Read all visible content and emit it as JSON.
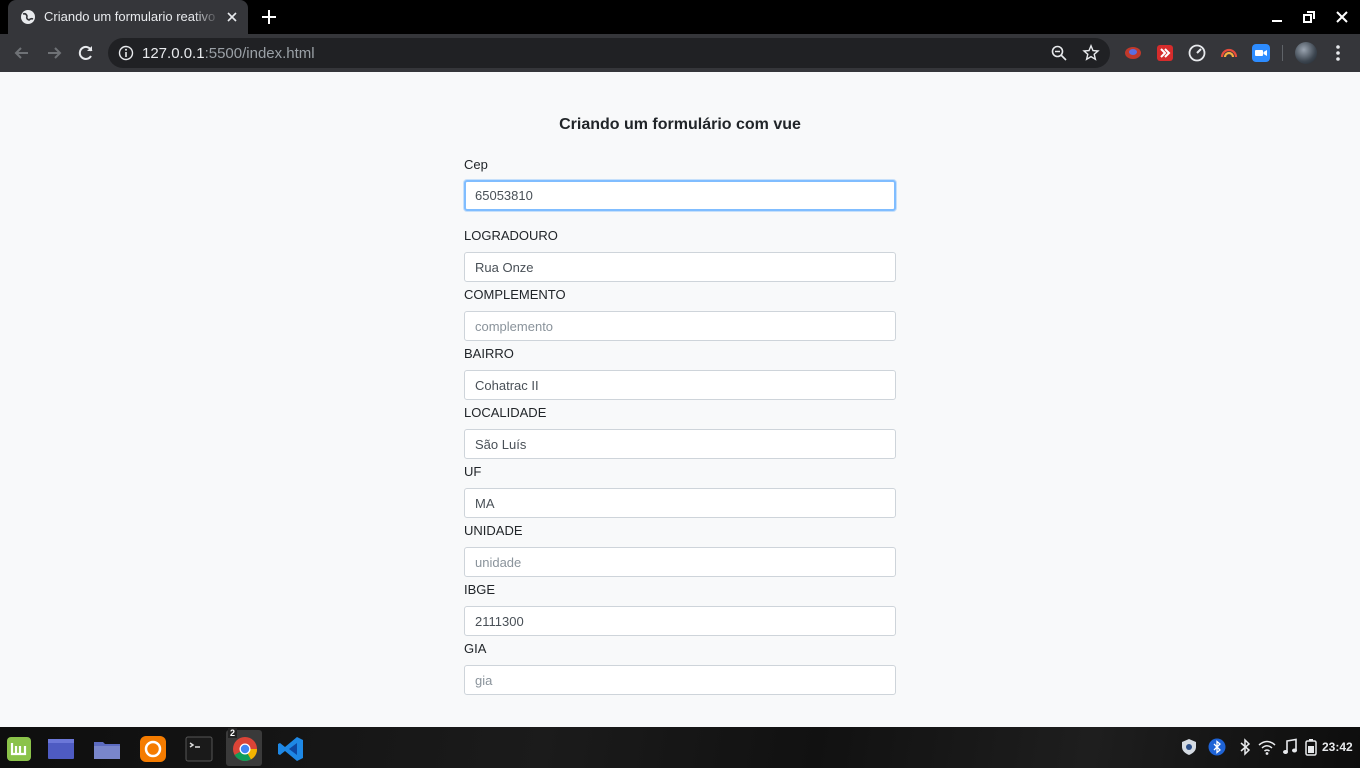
{
  "browser": {
    "tab_title": "Criando um formulario reativo com vue",
    "url_host": "127.0.0.1",
    "url_rest": ":5500/index.html"
  },
  "page": {
    "heading": "Criando um formulário com vue",
    "fields": [
      {
        "label": "Cep",
        "value": "65053810",
        "placeholder": ""
      },
      {
        "label": "LOGRADOURO",
        "value": "Rua Onze",
        "placeholder": ""
      },
      {
        "label": "COMPLEMENTO",
        "value": "",
        "placeholder": "complemento"
      },
      {
        "label": "BAIRRO",
        "value": "Cohatrac II",
        "placeholder": ""
      },
      {
        "label": "LOCALIDADE",
        "value": "São Luís",
        "placeholder": ""
      },
      {
        "label": "UF",
        "value": "MA",
        "placeholder": ""
      },
      {
        "label": "UNIDADE",
        "value": "",
        "placeholder": "unidade"
      },
      {
        "label": "IBGE",
        "value": "2111300",
        "placeholder": ""
      },
      {
        "label": "GIA",
        "value": "",
        "placeholder": "gia"
      }
    ]
  },
  "taskbar": {
    "chrome_badge": "2",
    "clock": "23:42"
  }
}
